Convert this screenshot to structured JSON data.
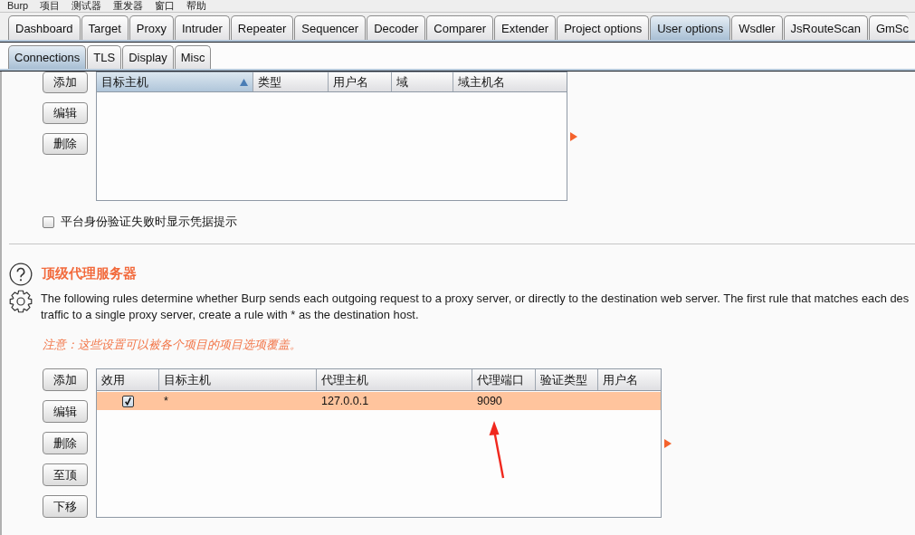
{
  "menu_bar": [
    "Burp",
    "项目",
    "测试器",
    "重发器",
    "窗口",
    "帮助"
  ],
  "main_tabs": [
    {
      "label": "Dashboard",
      "selected": false
    },
    {
      "label": "Target",
      "selected": false
    },
    {
      "label": "Proxy",
      "selected": false
    },
    {
      "label": "Intruder",
      "selected": false
    },
    {
      "label": "Repeater",
      "selected": false
    },
    {
      "label": "Sequencer",
      "selected": false
    },
    {
      "label": "Decoder",
      "selected": false
    },
    {
      "label": "Comparer",
      "selected": false
    },
    {
      "label": "Extender",
      "selected": false
    },
    {
      "label": "Project options",
      "selected": false
    },
    {
      "label": "User options",
      "selected": true
    },
    {
      "label": "Wsdler",
      "selected": false
    },
    {
      "label": "JsRouteScan",
      "selected": false
    },
    {
      "label": "GmSc",
      "selected": false
    }
  ],
  "sub_tabs": [
    {
      "label": "Connections",
      "selected": true
    },
    {
      "label": "TLS",
      "selected": false
    },
    {
      "label": "Display",
      "selected": false
    },
    {
      "label": "Misc",
      "selected": false
    }
  ],
  "platform_authentication": {
    "buttons": [
      "添加",
      "编辑",
      "删除"
    ],
    "table": {
      "columns": [
        {
          "label": "目标主机",
          "sorted": true
        },
        {
          "label": "类型",
          "sorted": false
        },
        {
          "label": "用户名",
          "sorted": false
        },
        {
          "label": "域",
          "sorted": false
        },
        {
          "label": "域主机名",
          "sorted": false
        }
      ]
    },
    "checkbox": {
      "label": "平台身份验证失败时显示凭据提示",
      "checked": false
    }
  },
  "upstream_proxy": {
    "title": "顶级代理服务器",
    "description": [
      "The following rules determine whether Burp sends each outgoing request to a proxy server, or directly to the destination web server. The first rule that matches each des",
      "traffic to a single proxy server, create a rule with * as the destination host."
    ],
    "note": "注意：这些设置可以被各个项目的项目选项覆盖。",
    "buttons": [
      "添加",
      "编辑",
      "删除",
      "至顶",
      "下移"
    ],
    "table": {
      "columns": [
        "效用",
        "目标主机",
        "代理主机",
        "代理端口",
        "验证类型",
        "用户名"
      ],
      "rows": [
        {
          "enabled": true,
          "selected": true,
          "cells": [
            "",
            "*",
            "127.0.0.1",
            "9090"
          ]
        }
      ]
    }
  }
}
